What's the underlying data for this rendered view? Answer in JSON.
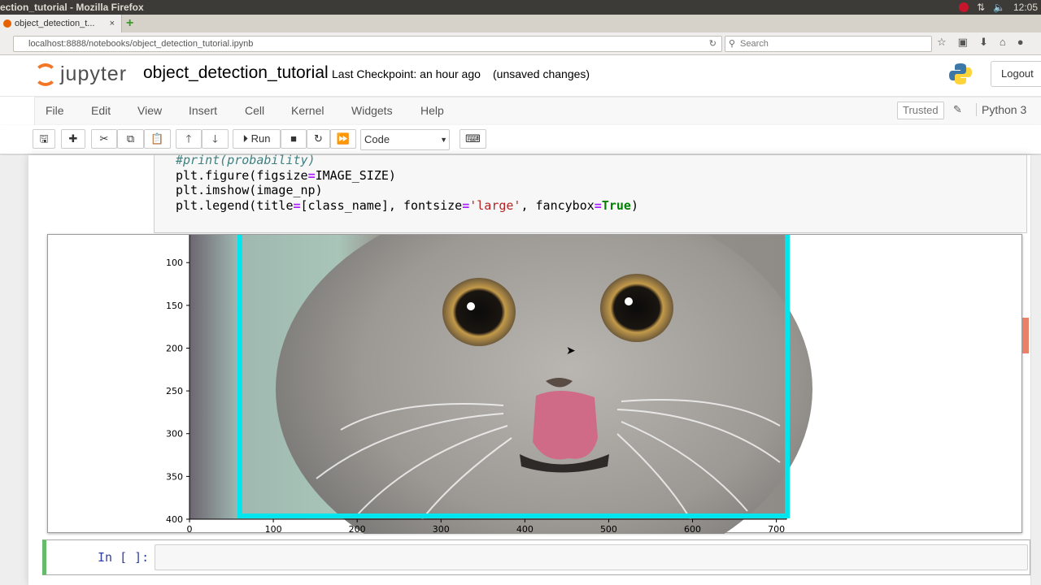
{
  "os": {
    "window_title": "ection_tutorial - Mozilla Firefox",
    "clock": "12:05"
  },
  "browser": {
    "tab_title": "object_detection_t...",
    "tab_close": "×",
    "new_tab": "+",
    "url": "localhost:8888/notebooks/object_detection_tutorial.ipynb",
    "search_placeholder": "Search"
  },
  "jupyter": {
    "logo_text": "jupyter",
    "notebook_name": "object_detection_tutorial",
    "checkpoint": "Last Checkpoint: an hour ago",
    "unsaved": "(unsaved changes)",
    "logout": "Logout"
  },
  "menu": {
    "items": [
      "File",
      "Edit",
      "View",
      "Insert",
      "Cell",
      "Kernel",
      "Widgets",
      "Help"
    ],
    "trusted": "Trusted",
    "kernel": "Python 3"
  },
  "toolbar": {
    "run_label": "Run",
    "cell_type": "Code"
  },
  "code": {
    "line1_comment": "#print(probability)",
    "line2": [
      "plt",
      ".figure(figsize",
      "=",
      "IMAGE_SIZE)"
    ],
    "line3": "plt.imshow(image_np)",
    "line4": [
      "plt.legend(title",
      "=",
      "[class_name], fontsize",
      "=",
      "'large'",
      ", fancybox",
      "=",
      "True",
      ")"
    ]
  },
  "chart_data": {
    "type": "image",
    "title": "",
    "xlabel": "",
    "ylabel": "",
    "xticks": [
      "0",
      "100",
      "200",
      "300",
      "400",
      "500",
      "600",
      "700"
    ],
    "yticks": [
      "100",
      "150",
      "200",
      "250",
      "300",
      "350",
      "400"
    ],
    "xlim": [
      0,
      712
    ],
    "ylim": [
      400,
      58
    ],
    "detection_box": {
      "xmin": 58,
      "xmax": 715,
      "ymin": 58,
      "ymax": 400,
      "color": "#00e5ee"
    }
  },
  "next_cell": {
    "prompt": "In [ ]:"
  },
  "colors": {
    "jupyter_orange": "#f37626",
    "edit_mode_green": "#66bb6a",
    "box_cyan": "#00e5ee"
  }
}
